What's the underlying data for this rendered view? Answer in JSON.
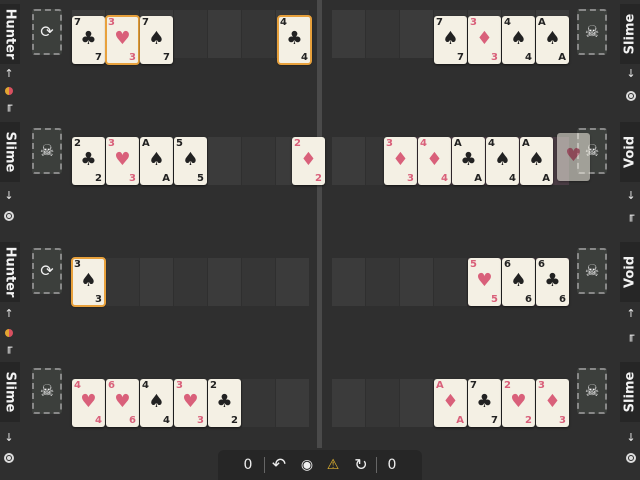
{
  "colors": {
    "background": "#2f2f2f",
    "card_face": "#f4f0e4",
    "red_suit": "#d9607a",
    "black_suit": "#222222",
    "selection": "#e8a13c"
  },
  "players": {
    "p1": {
      "name": "Hunter",
      "avatar_icon": "swap-icon",
      "avatar_glyph": "⟳"
    },
    "p2": {
      "name": "Slime",
      "avatar_icon": "skull-icon",
      "avatar_glyph": "☠"
    },
    "p3": {
      "name": "Hunter",
      "avatar_icon": "swap-icon",
      "avatar_glyph": "⟳"
    },
    "p4": {
      "name": "Slime",
      "avatar_icon": "skull-icon",
      "avatar_glyph": "☠"
    },
    "p5": {
      "name": "Slime",
      "avatar_icon": "skull-icon",
      "avatar_glyph": "☠"
    },
    "p6": {
      "name": "Void",
      "avatar_icon": "skull-icon",
      "avatar_glyph": "☠"
    },
    "p7": {
      "name": "Void",
      "avatar_icon": "skull-icon",
      "avatar_glyph": "☠"
    },
    "p8": {
      "name": "Slime",
      "avatar_icon": "skull-icon",
      "avatar_glyph": "☠"
    }
  },
  "side_icons": {
    "arrow_up": "↑",
    "arrow_down": "↓",
    "stairs": "╓"
  },
  "cards": {
    "r1l": [
      {
        "rank": "7",
        "suit": "♣",
        "color": "black"
      },
      {
        "rank": "3",
        "suit": "♥",
        "color": "red",
        "selected": true
      },
      {
        "rank": "7",
        "suit": "♠",
        "color": "black"
      },
      {
        "rank": "4",
        "suit": "♣",
        "color": "black",
        "selected": true
      }
    ],
    "r1r": [
      {
        "rank": "7",
        "suit": "♠",
        "color": "black"
      },
      {
        "rank": "3",
        "suit": "♦",
        "color": "red"
      },
      {
        "rank": "4",
        "suit": "♠",
        "color": "black"
      },
      {
        "rank": "A",
        "suit": "♠",
        "color": "black"
      }
    ],
    "r2l": [
      {
        "rank": "2",
        "suit": "♣",
        "color": "black"
      },
      {
        "rank": "3",
        "suit": "♥",
        "color": "red"
      },
      {
        "rank": "A",
        "suit": "♠",
        "color": "black"
      },
      {
        "rank": "5",
        "suit": "♠",
        "color": "black"
      },
      {
        "rank": "2",
        "suit": "♦",
        "color": "red"
      }
    ],
    "r2r": [
      {
        "rank": "3",
        "suit": "♦",
        "color": "red"
      },
      {
        "rank": "4",
        "suit": "♦",
        "color": "red"
      },
      {
        "rank": "A",
        "suit": "♣",
        "color": "black"
      },
      {
        "rank": "4",
        "suit": "♠",
        "color": "black"
      },
      {
        "rank": "A",
        "suit": "♠",
        "color": "black"
      },
      {
        "rank": "",
        "suit": "♥",
        "color": "red",
        "faded": true
      }
    ],
    "r3l": [
      {
        "rank": "3",
        "suit": "♠",
        "color": "black",
        "selected": true
      }
    ],
    "r3r": [
      {
        "rank": "5",
        "suit": "♥",
        "color": "red"
      },
      {
        "rank": "6",
        "suit": "♠",
        "color": "black"
      },
      {
        "rank": "6",
        "suit": "♣",
        "color": "black"
      }
    ],
    "r4l": [
      {
        "rank": "4",
        "suit": "♥",
        "color": "red"
      },
      {
        "rank": "6",
        "suit": "♥",
        "color": "red"
      },
      {
        "rank": "4",
        "suit": "♠",
        "color": "black"
      },
      {
        "rank": "3",
        "suit": "♥",
        "color": "red"
      },
      {
        "rank": "2",
        "suit": "♣",
        "color": "black"
      }
    ],
    "r4r": [
      {
        "rank": "A",
        "suit": "♦",
        "color": "red"
      },
      {
        "rank": "7",
        "suit": "♣",
        "color": "black"
      },
      {
        "rank": "2",
        "suit": "♥",
        "color": "red"
      },
      {
        "rank": "3",
        "suit": "♦",
        "color": "red"
      }
    ]
  },
  "toolbar": {
    "left_count": "0",
    "undo_icon": "↶",
    "eye_icon": "◉",
    "warning_icon": "⚠",
    "redo_icon": "↻",
    "right_count": "0"
  }
}
